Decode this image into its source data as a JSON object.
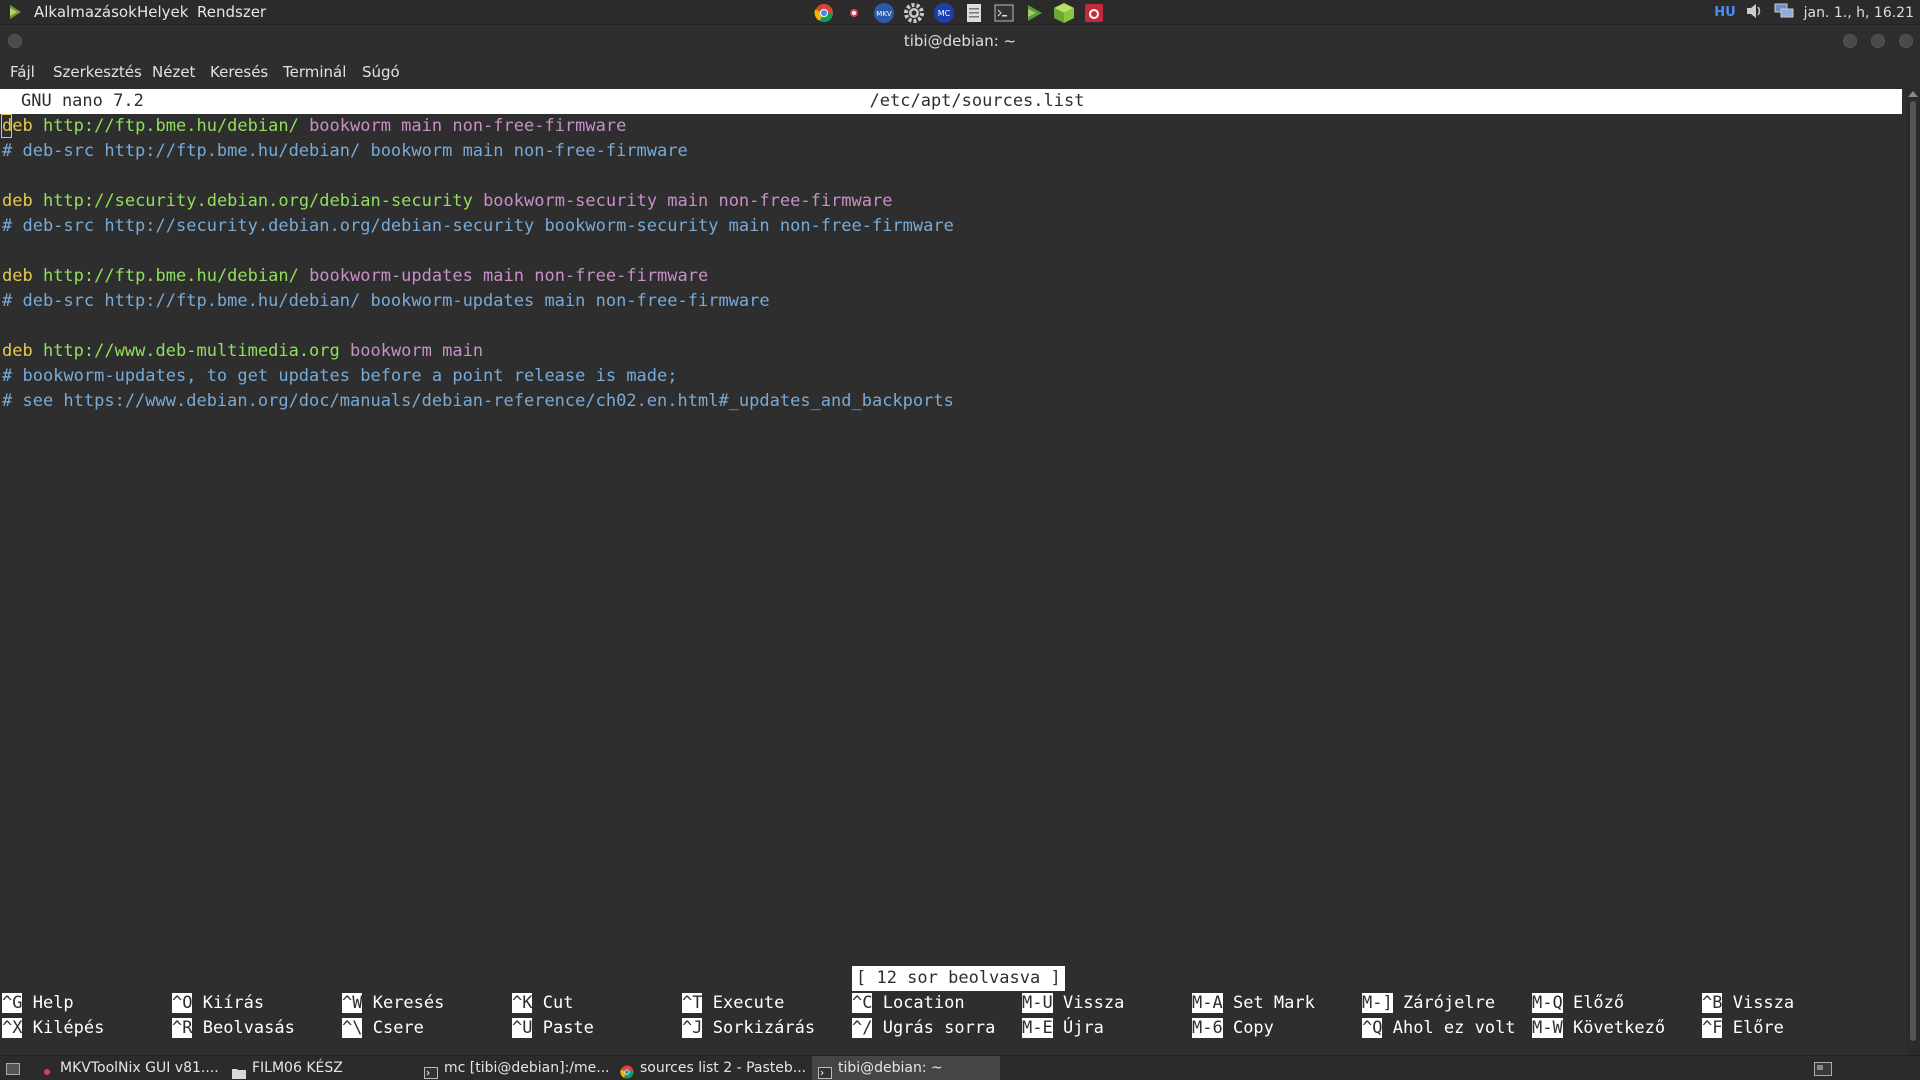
{
  "top_panel": {
    "menus": [
      "Alkalmazások",
      "Helyek",
      "Rendszer"
    ],
    "tray_icons": [
      "chrome-icon",
      "red-dot-icon",
      "mkv-icon",
      "settings-gear-icon",
      "mc-icon",
      "document-icon",
      "terminal-icon",
      "play-icon",
      "cube-icon",
      "raspberry-icon"
    ],
    "keyboard_layout": "HU",
    "clock": "jan. 1., h, 16.21"
  },
  "window": {
    "title": "tibi@debian: ~"
  },
  "menubar": {
    "items": [
      "Fájl",
      "Szerkesztés",
      "Nézet",
      "Keresés",
      "Terminál",
      "Súgó"
    ]
  },
  "nano": {
    "version": "GNU nano 7.2",
    "filename": "/etc/apt/sources.list",
    "lines": [
      {
        "type": "deb",
        "kw": "deb",
        "url": "http://ftp.bme.hu/debian/",
        "rest": "bookworm main non-free-firmware"
      },
      {
        "type": "comment",
        "text": "# deb-src http://ftp.bme.hu/debian/ bookworm main non-free-firmware"
      },
      {
        "type": "blank"
      },
      {
        "type": "deb",
        "kw": "deb",
        "url": "http://security.debian.org/debian-security",
        "rest": "bookworm-security main non-free-firmware"
      },
      {
        "type": "comment",
        "text": "# deb-src http://security.debian.org/debian-security bookworm-security main non-free-firmware"
      },
      {
        "type": "blank"
      },
      {
        "type": "deb",
        "kw": "deb",
        "url": "http://ftp.bme.hu/debian/",
        "rest": "bookworm-updates main non-free-firmware"
      },
      {
        "type": "comment",
        "text": "# deb-src http://ftp.bme.hu/debian/ bookworm-updates main non-free-firmware"
      },
      {
        "type": "blank"
      },
      {
        "type": "deb",
        "kw": "deb",
        "url": "http://www.deb-multimedia.org",
        "rest": "bookworm main"
      },
      {
        "type": "comment",
        "text": "# bookworm-updates, to get updates before a point release is made;"
      },
      {
        "type": "comment",
        "text": "# see https://www.debian.org/doc/manuals/debian-reference/ch02.en.html#_updates_and_backports"
      }
    ],
    "status": "[ 12 sor beolvasva ]",
    "shortcuts_row1": [
      {
        "key": "^G",
        "label": "Help"
      },
      {
        "key": "^O",
        "label": "Kiírás"
      },
      {
        "key": "^W",
        "label": "Keresés"
      },
      {
        "key": "^K",
        "label": "Cut"
      },
      {
        "key": "^T",
        "label": "Execute"
      },
      {
        "key": "^C",
        "label": "Location"
      },
      {
        "key": "M-U",
        "label": "Vissza"
      },
      {
        "key": "M-A",
        "label": "Set Mark"
      },
      {
        "key": "M-]",
        "label": "Zárójelre"
      },
      {
        "key": "M-Q",
        "label": "Előző"
      },
      {
        "key": "^B",
        "label": "Vissza"
      }
    ],
    "shortcuts_row2": [
      {
        "key": "^X",
        "label": "Kilépés"
      },
      {
        "key": "^R",
        "label": "Beolvasás"
      },
      {
        "key": "^\\",
        "label": "Csere"
      },
      {
        "key": "^U",
        "label": "Paste"
      },
      {
        "key": "^J",
        "label": "Sorkizárás"
      },
      {
        "key": "^/",
        "label": "Ugrás sorra"
      },
      {
        "key": "M-E",
        "label": "Újra"
      },
      {
        "key": "M-6",
        "label": "Copy"
      },
      {
        "key": "^Q",
        "label": "Ahol ez volt"
      },
      {
        "key": "M-W",
        "label": "Következő"
      },
      {
        "key": "^F",
        "label": "Előre"
      }
    ]
  },
  "taskbar": {
    "items": [
      {
        "icon": "mkvtoolnix-icon",
        "label": "MKVToolNix GUI v81...."
      },
      {
        "icon": "folder-icon",
        "label": "FILM06 KÉSZ"
      },
      {
        "icon": "terminal-icon",
        "label": "mc [tibi@debian]:/me..."
      },
      {
        "icon": "chrome-icon",
        "label": "sources list 2 - Pasteb..."
      },
      {
        "icon": "terminal-icon",
        "label": "tibi@debian: ~"
      }
    ]
  },
  "colors": {
    "background": "#2e2e2e",
    "keyword": "#e5c94f",
    "url": "#8fe05a",
    "distribution": "#c88fc8",
    "comment": "#78aad8"
  }
}
